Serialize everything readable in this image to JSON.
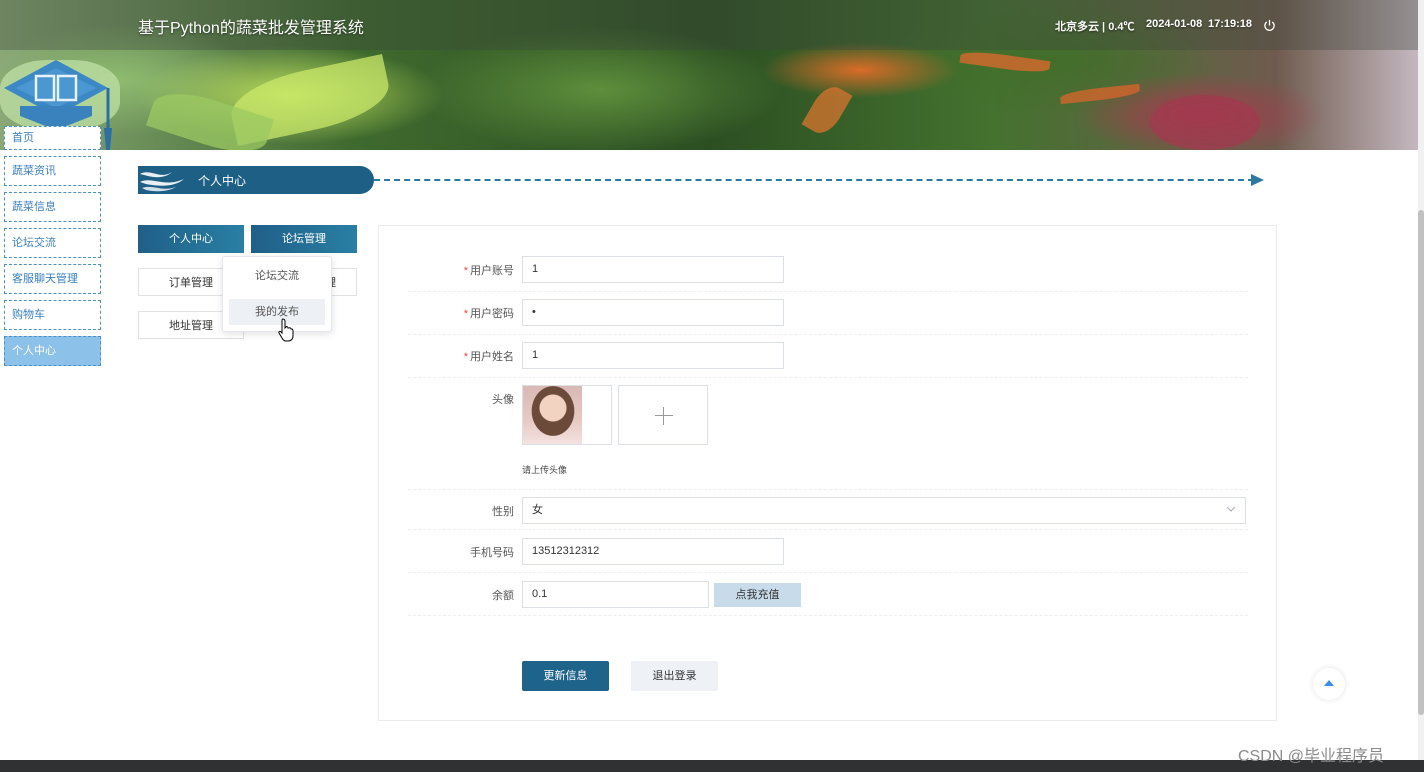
{
  "header": {
    "site_title": "基于Python的蔬菜批发管理系统",
    "weather": "北京多云 | 0.4℃",
    "date": "2024-01-08",
    "time": "17:19:18",
    "power_icon": "power-icon"
  },
  "sidebar": {
    "items": [
      {
        "label": "首页"
      },
      {
        "label": "蔬菜资讯"
      },
      {
        "label": "蔬菜信息"
      },
      {
        "label": "论坛交流"
      },
      {
        "label": "客服聊天管理"
      },
      {
        "label": "购物车"
      },
      {
        "label": "个人中心"
      }
    ],
    "active_index": 6
  },
  "section": {
    "title": "个人中心"
  },
  "tabs": {
    "personal_center": "个人中心",
    "forum_manage": "论坛管理",
    "order_manage": "订单管理",
    "collect_partial": "理",
    "address_manage": "地址管理"
  },
  "dropdown": {
    "items": [
      "论坛交流",
      "我的发布"
    ],
    "hovered_index": 1
  },
  "form": {
    "account": {
      "label": "用户账号",
      "value": "1"
    },
    "password": {
      "label": "用户密码",
      "value": "•"
    },
    "name": {
      "label": "用户姓名",
      "value": "1"
    },
    "avatar": {
      "label": "头像",
      "hint": "请上传头像"
    },
    "gender": {
      "label": "性别",
      "value": "女"
    },
    "phone": {
      "label": "手机号码",
      "value": "13512312312"
    },
    "balance": {
      "label": "余额",
      "value": "0.1",
      "recharge": "点我充值"
    },
    "required_mark": "*",
    "update_button": "更新信息",
    "logout_button": "退出登录"
  },
  "watermark": "CSDN @毕业程序员",
  "colors": {
    "primary": "#1e6389",
    "nav_border": "#4a8fc6",
    "nav_active": "#8cc2ea",
    "required": "#e04b4b"
  }
}
